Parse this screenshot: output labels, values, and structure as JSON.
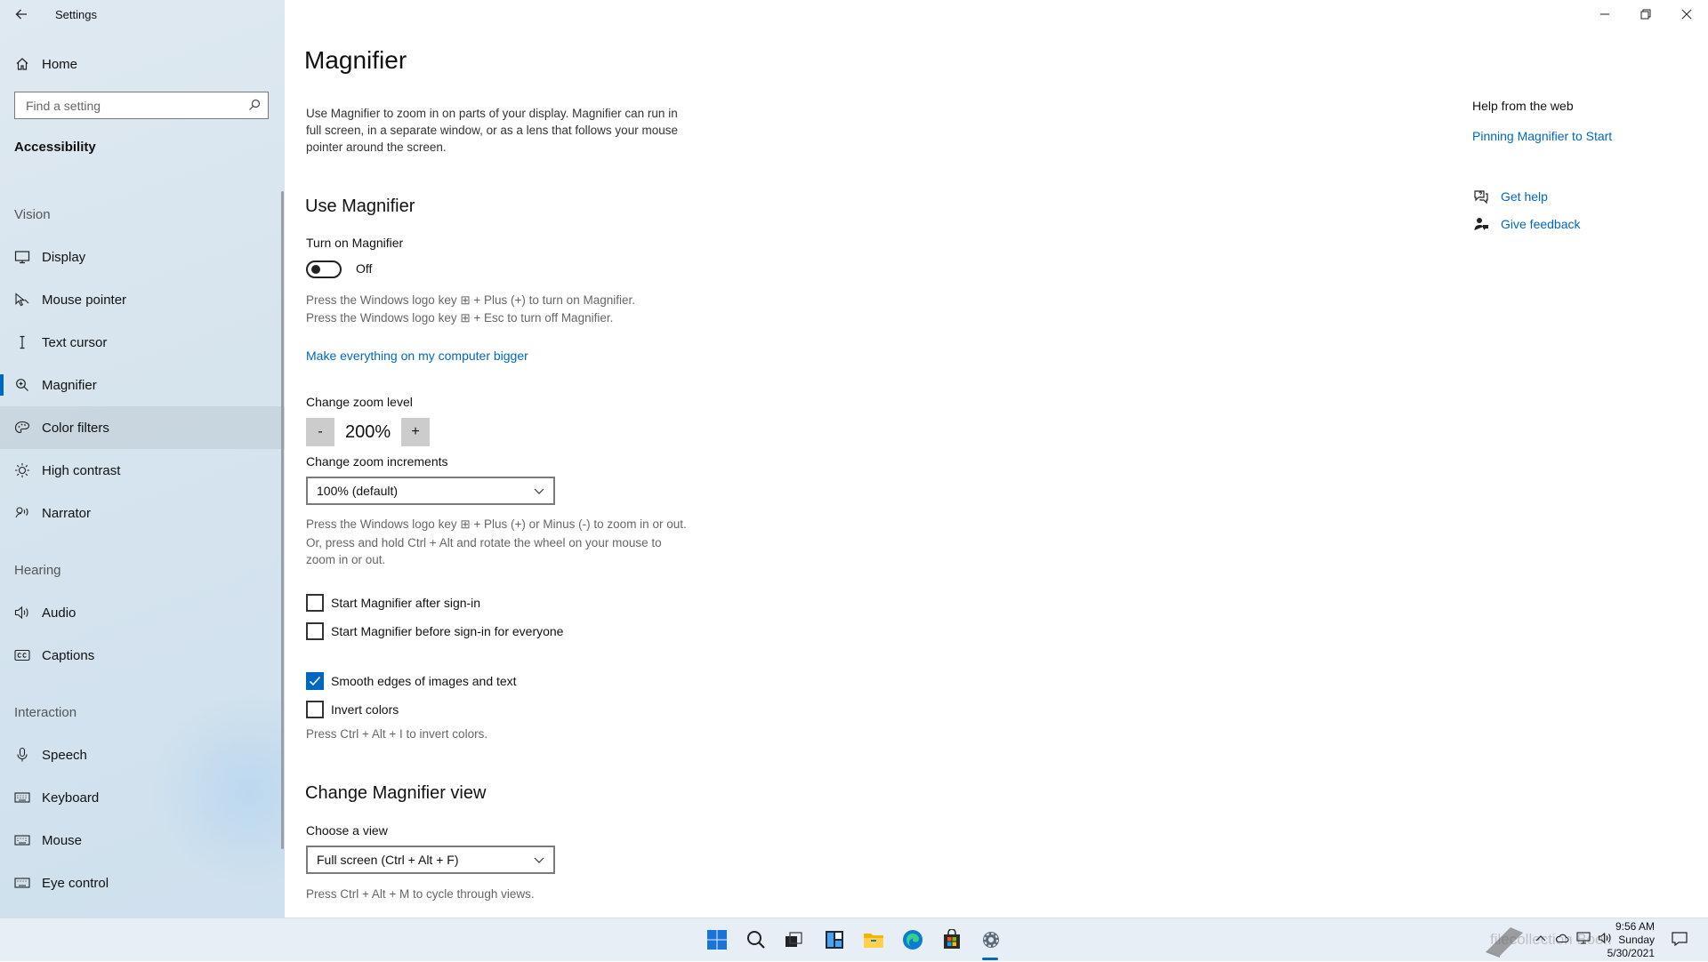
{
  "window": {
    "title": "Settings"
  },
  "sidebar": {
    "home_label": "Home",
    "search_placeholder": "Find a setting",
    "category": "Accessibility",
    "sections": {
      "vision": "Vision",
      "hearing": "Hearing",
      "interaction": "Interaction"
    },
    "items": {
      "display": "Display",
      "mouse_pointer": "Mouse pointer",
      "text_cursor": "Text cursor",
      "magnifier": "Magnifier",
      "color_filters": "Color filters",
      "high_contrast": "High contrast",
      "narrator": "Narrator",
      "audio": "Audio",
      "captions": "Captions",
      "speech": "Speech",
      "keyboard": "Keyboard",
      "mouse": "Mouse",
      "eye_control": "Eye control"
    },
    "active_item": "Magnifier"
  },
  "main": {
    "title": "Magnifier",
    "description": [
      "Use Magnifier to zoom in on parts of your display. Magnifier can run in",
      "full screen, in a separate window, or as a lens that follows your mouse",
      "pointer around the screen."
    ],
    "use_magnifier": {
      "heading": "Use Magnifier",
      "toggle_label": "Turn on Magnifier",
      "toggle_state": "Off",
      "toggle_on": false,
      "hint_lines": [
        "Press the Windows logo key ⊞ + Plus (+) to turn on Magnifier.",
        "Press the Windows logo key ⊞ + Esc to turn off Magnifier."
      ],
      "bigger_link": "Make everything on my computer bigger"
    },
    "zoom": {
      "label": "Change zoom level",
      "minus": "-",
      "value": "200%",
      "plus": "+",
      "increments_label": "Change zoom increments",
      "increments_value": "100% (default)",
      "hint_lines": [
        "Press the Windows logo key ⊞ + Plus (+) or Minus (-) to zoom in or out.",
        "Or, press and hold Ctrl + Alt and rotate the wheel on your mouse to",
        "zoom in or out."
      ]
    },
    "checkboxes": [
      {
        "label": "Start Magnifier after sign-in",
        "checked": false
      },
      {
        "label": "Start Magnifier before sign-in for everyone",
        "checked": false
      },
      {
        "label": "Smooth edges of images and text",
        "checked": true
      },
      {
        "label": "Invert colors",
        "checked": false
      }
    ],
    "invert_hint": "Press Ctrl + Alt + I to invert colors.",
    "view": {
      "heading": "Change Magnifier view",
      "choose_label": "Choose a view",
      "choose_value": "Full screen (Ctrl + Alt + F)",
      "hint": "Press Ctrl + Alt + M to cycle through views."
    }
  },
  "help": {
    "heading": "Help from the web",
    "web_link": "Pinning Magnifier to Start",
    "get_help": "Get help",
    "give_feedback": "Give feedback"
  },
  "taskbar": {
    "icons": [
      "windows-start-icon",
      "search-icon",
      "task-view-icon",
      "widgets-icon",
      "file-explorer-icon",
      "edge-icon",
      "store-icon",
      "settings-icon"
    ],
    "clock": {
      "time": "9:56 AM",
      "day": "Sunday",
      "date": "5/30/2021"
    },
    "watermark": "filecollection Book"
  },
  "colors": {
    "accent": "#0067c0",
    "sidebar_bg": "#d6e4ee",
    "taskbar_bg": "#e8eef5"
  }
}
